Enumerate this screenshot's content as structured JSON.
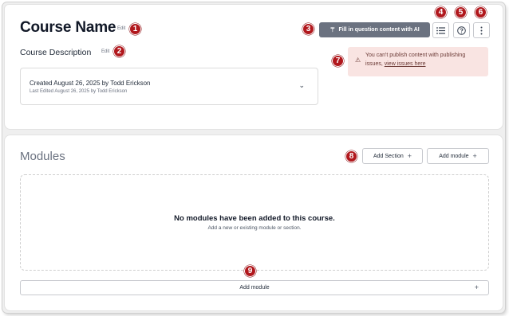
{
  "course": {
    "title": "Course Name",
    "title_edit": "Edit",
    "description": "Course Description",
    "description_edit": "Edit",
    "created": "Created August 26, 2025 by Todd Erickson",
    "last_edited": "Last Edited August 26, 2025 by Todd Erickson"
  },
  "toolbar": {
    "ai_button_label": "Fill in question content with AI",
    "list_icon": "list-icon",
    "help_icon": "help-circle-icon",
    "more_icon": "more-vertical-icon"
  },
  "warning": {
    "text": "You can't publish content with publishing issues,",
    "link_text": "view issues here"
  },
  "modules": {
    "title": "Modules",
    "add_section_label": "Add Section",
    "add_module_label": "Add module",
    "empty_title": "No modules have been added to this course.",
    "empty_subtitle": "Add a new or existing module or section.",
    "bottom_add_module_label": "Add module"
  },
  "callouts": [
    "1",
    "2",
    "3",
    "4",
    "5",
    "6",
    "7",
    "8",
    "9"
  ],
  "colors": {
    "badge": "#b1181d",
    "ai_button": "#6b7280",
    "warning_bg": "#f9e4e2",
    "page_bg": "#efefef"
  }
}
